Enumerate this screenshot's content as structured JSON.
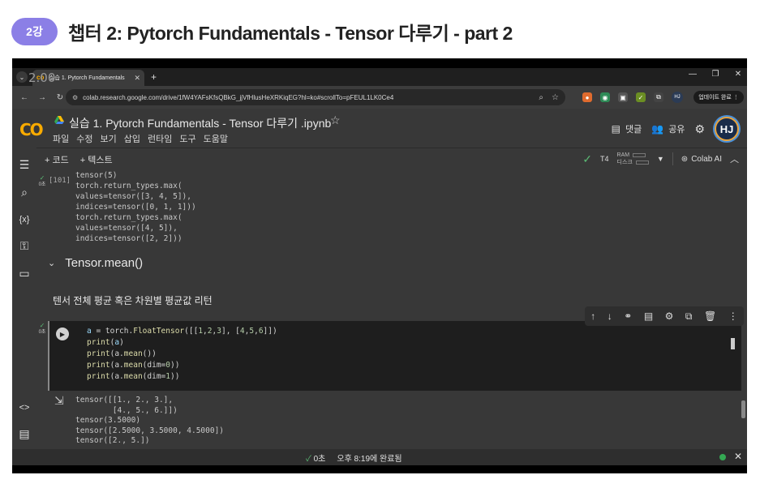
{
  "lesson": {
    "badge": "2강",
    "title": "챕터 2: Pytorch Fundamentals - Tensor 다루기 - part 2",
    "badge_color": "#8b7fe6"
  },
  "player": {
    "speed": "2.00"
  },
  "browser": {
    "tab_title": "실습 1. Pytorch Fundamentals",
    "url": "colab.research.google.com/drive/1fW4YAFsKfsQBkG_jjVfHlusHeXRKiqEG?hl=ko#scrollTo=pFEUL1LK0Ce4",
    "avatar_small": "HJ",
    "update_button": "업데이트 완료"
  },
  "colab": {
    "logo": "CO",
    "notebook_title": "실습 1. Pytorch Fundamentals  - Tensor 다루기 .ipynb",
    "menus": [
      "파일",
      "수정",
      "보기",
      "삽입",
      "런타임",
      "도구",
      "도움말"
    ],
    "comment_label": "댓글",
    "share_label": "공유",
    "avatar": "HJ",
    "add_code": "+ 코드",
    "add_text": "+ 텍스트",
    "runtime": "T4",
    "ram_label": "RAM",
    "disk_label": "디스크",
    "colab_ai": "Colab AI"
  },
  "cells": {
    "prev_exec_count": "[101]",
    "prev_exec_time": "0초",
    "prev_output": "tensor(5)\ntorch.return_types.max(\nvalues=tensor([3, 4, 5]),\nindices=tensor([0, 1, 1]))\ntorch.return_types.max(\nvalues=tensor([4, 5]),\nindices=tensor([2, 2]))",
    "section_title": "Tensor.mean()",
    "section_desc": "텐서 전체 평균 혹은 차원별 평균값 리턴",
    "code_exec_time": "0초",
    "code_output": "tensor([[1., 2., 3.],\n        [4., 5., 6.]])\ntensor(3.5000)\ntensor([2.5000, 3.5000, 4.5000])\ntensor([2., 5.])"
  },
  "status": {
    "duration": "0초",
    "completed": "오후 8:19에 완료됨"
  }
}
